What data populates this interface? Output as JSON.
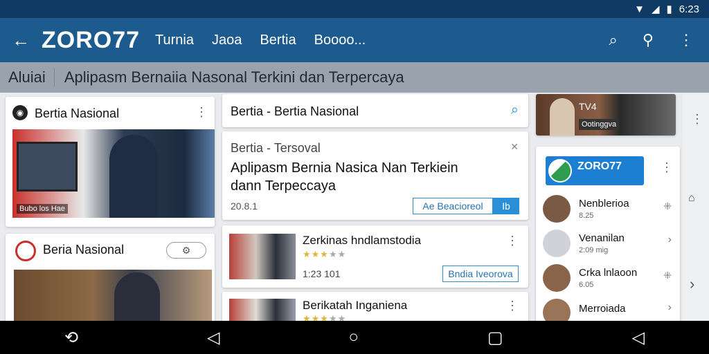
{
  "status": {
    "time": "6:23",
    "icons": [
      "wifi-icon",
      "signal-icon",
      "battery-icon"
    ]
  },
  "appbar": {
    "title": "ZORO77",
    "nav": [
      "Turnia",
      "Jaoa",
      "Bertia",
      "Boooo..."
    ]
  },
  "subbar": {
    "tag": "Aluiai",
    "headline": "Aplipasm Bernaiia Nasonal Terkini dan Terpercaya"
  },
  "left": {
    "card1": {
      "title": "Bertia Nasional",
      "caption": "Bubo los Hae"
    },
    "card2": {
      "title": "Beria Nasional"
    }
  },
  "middle": {
    "header": {
      "title": "Bertia - Bertia Nasional"
    },
    "feature": {
      "kicker": "Bertia - Tersoval",
      "headline": "Aplipasm Bernia Nasica Nan Terkiein dann Terpeccaya",
      "meta": "20.8.1",
      "button": "Ae Beacioreol",
      "button_tag": "Ib"
    },
    "item1": {
      "title": "Zerkinas hndlamstodia",
      "meta": "1:23 101",
      "rating": 3,
      "button": "Bndia Iveorova"
    },
    "item2": {
      "title": "Berikatah Inganiena",
      "rating": 3
    }
  },
  "right": {
    "top": {
      "title": "TV4",
      "caption": "Ootinggva"
    },
    "brand": {
      "title": "ZORO77"
    },
    "list": [
      {
        "name": "Nenblerioa",
        "sub": "8.25"
      },
      {
        "name": "Venanilan",
        "sub": "2:09 mig"
      },
      {
        "name": "Crka lnlaoon",
        "sub": "6.05"
      },
      {
        "name": "Merroiada",
        "sub": ""
      }
    ]
  },
  "colors": {
    "appbar": "#1d5a8e",
    "accent": "#2a8fd6",
    "subbar": "#9aa3ad"
  }
}
